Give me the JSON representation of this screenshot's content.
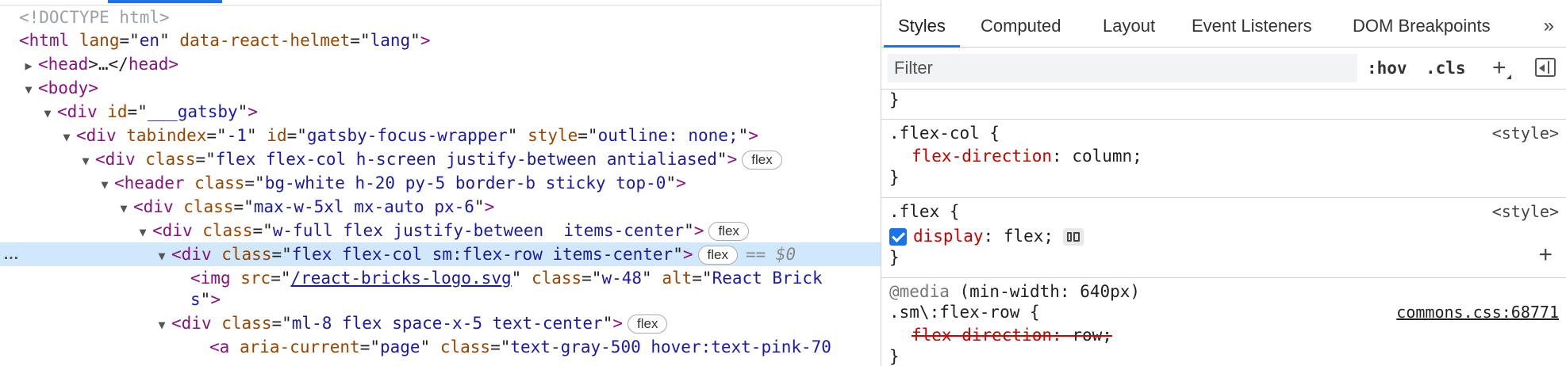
{
  "dom": {
    "doctype": "<!DOCTYPE html>",
    "line1": {
      "open": "<",
      "tag": "html",
      "a1": "lang",
      "v1": "en",
      "a2": "data-react-helmet",
      "v2": "lang",
      "close": ">"
    },
    "line2": {
      "open": "<",
      "tag": "head",
      "mid": ">…</",
      "tag2": "head",
      "close": ">"
    },
    "line3": {
      "open": "<",
      "tag": "body",
      "close": ">"
    },
    "line4": {
      "open": "<",
      "tag": "div",
      "a1": "id",
      "v1": "___gatsby",
      "close": ">"
    },
    "line5": {
      "open": "<",
      "tag": "div",
      "a1": "tabindex",
      "v1": "-1",
      "a2": "id",
      "v2": "gatsby-focus-wrapper",
      "a3": "style",
      "v3": "outline: none;",
      "close": ">"
    },
    "line6": {
      "open": "<",
      "tag": "div",
      "a1": "class",
      "v1": "flex flex-col h-screen justify-between antialiased",
      "close": ">",
      "badge": "flex"
    },
    "line7": {
      "open": "<",
      "tag": "header",
      "a1": "class",
      "v1": "bg-white h-20 py-5 border-b sticky top-0",
      "close": ">"
    },
    "line8": {
      "open": "<",
      "tag": "div",
      "a1": "class",
      "v1": "max-w-5xl mx-auto px-6",
      "close": ">"
    },
    "line9": {
      "open": "<",
      "tag": "div",
      "a1": "class",
      "v1": "w-full flex justify-between  items-center",
      "close": ">",
      "badge": "flex"
    },
    "line10": {
      "dots": "…",
      "open": "<",
      "tag": "div",
      "a1": "class",
      "v1": "flex flex-col sm:flex-row items-center",
      "close": ">",
      "badge": "flex",
      "eq": "== $0"
    },
    "line11": {
      "open": "<",
      "tag": "img",
      "a1": "src",
      "v1": "/react-bricks-logo.svg",
      "a2": "class",
      "v2": "w-48",
      "a3": "alt",
      "v3a": "React Brick"
    },
    "line12": {
      "v3b": "s",
      "close": ">"
    },
    "line13": {
      "open": "<",
      "tag": "div",
      "a1": "class",
      "v1": "ml-8 flex space-x-5 text-center",
      "close": ">",
      "badge": "flex"
    },
    "line14": {
      "open": "<",
      "tag": "a",
      "a1": "aria-current",
      "v1": "page",
      "a2": "class",
      "v2": "text-gray-500 hover:text-pink-70"
    }
  },
  "tabs": [
    "Styles",
    "Computed",
    "Layout",
    "Event Listeners",
    "DOM Breakpoints"
  ],
  "tabs_more": "»",
  "toolbar": {
    "filter_placeholder": "Filter",
    "hov": ":hov",
    "cls": ".cls",
    "add": "+"
  },
  "rules": {
    "prev_close": "}",
    "r1": {
      "selector": ".flex-col {",
      "source": "<style>",
      "prop": "flex-direction",
      "value": " column;",
      "close": "}"
    },
    "r2": {
      "selector": ".flex {",
      "source": "<style>",
      "prop": "display",
      "value": " flex;",
      "close": "}",
      "add": "+"
    },
    "r3": {
      "media_kw": "@media",
      "media_q": " (min-width: 640px)",
      "selector": ".sm\\:flex-row {",
      "source": "commons.css:68771",
      "prop": "flex-direction",
      "value": " row;",
      "close": "}"
    }
  }
}
